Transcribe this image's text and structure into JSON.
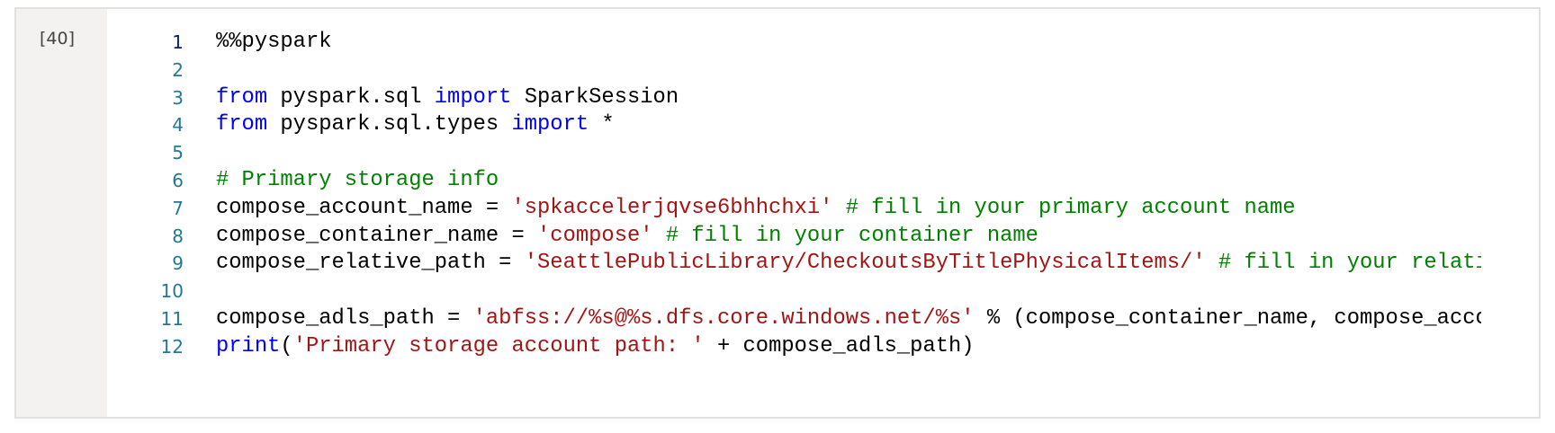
{
  "cell": {
    "execution_count": "[40]",
    "lines": [
      {
        "n": "1",
        "tokens": [
          {
            "t": "plain",
            "v": "%%pyspark"
          }
        ]
      },
      {
        "n": "2",
        "tokens": []
      },
      {
        "n": "3",
        "tokens": [
          {
            "t": "kw",
            "v": "from"
          },
          {
            "t": "plain",
            "v": " pyspark.sql "
          },
          {
            "t": "kw",
            "v": "import"
          },
          {
            "t": "plain",
            "v": " SparkSession"
          }
        ]
      },
      {
        "n": "4",
        "tokens": [
          {
            "t": "kw",
            "v": "from"
          },
          {
            "t": "plain",
            "v": " pyspark.sql.types "
          },
          {
            "t": "kw",
            "v": "import"
          },
          {
            "t": "plain",
            "v": " *"
          }
        ]
      },
      {
        "n": "5",
        "tokens": []
      },
      {
        "n": "6",
        "tokens": [
          {
            "t": "cm",
            "v": "# Primary storage info"
          }
        ]
      },
      {
        "n": "7",
        "tokens": [
          {
            "t": "plain",
            "v": "compose_account_name = "
          },
          {
            "t": "str",
            "v": "'spkaccelerjqvse6bhhchxi'"
          },
          {
            "t": "plain",
            "v": " "
          },
          {
            "t": "cm",
            "v": "# fill in your primary account name"
          }
        ]
      },
      {
        "n": "8",
        "tokens": [
          {
            "t": "plain",
            "v": "compose_container_name = "
          },
          {
            "t": "str",
            "v": "'compose'"
          },
          {
            "t": "plain",
            "v": " "
          },
          {
            "t": "cm",
            "v": "# fill in your container name"
          }
        ]
      },
      {
        "n": "9",
        "tokens": [
          {
            "t": "plain",
            "v": "compose_relative_path = "
          },
          {
            "t": "str",
            "v": "'SeattlePublicLibrary/CheckoutsByTitlePhysicalItems/'"
          },
          {
            "t": "plain",
            "v": " "
          },
          {
            "t": "cm",
            "v": "# fill in your relati"
          }
        ]
      },
      {
        "n": "10",
        "tokens": []
      },
      {
        "n": "11",
        "tokens": [
          {
            "t": "plain",
            "v": "compose_adls_path = "
          },
          {
            "t": "str",
            "v": "'abfss://%s@%s.dfs.core.windows.net/%s'"
          },
          {
            "t": "plain",
            "v": " % (compose_container_name, compose_acco"
          }
        ]
      },
      {
        "n": "12",
        "tokens": [
          {
            "t": "kw",
            "v": "print"
          },
          {
            "t": "plain",
            "v": "("
          },
          {
            "t": "str",
            "v": "'Primary storage account path: '"
          },
          {
            "t": "plain",
            "v": " + compose_adls_path)"
          }
        ]
      }
    ]
  }
}
